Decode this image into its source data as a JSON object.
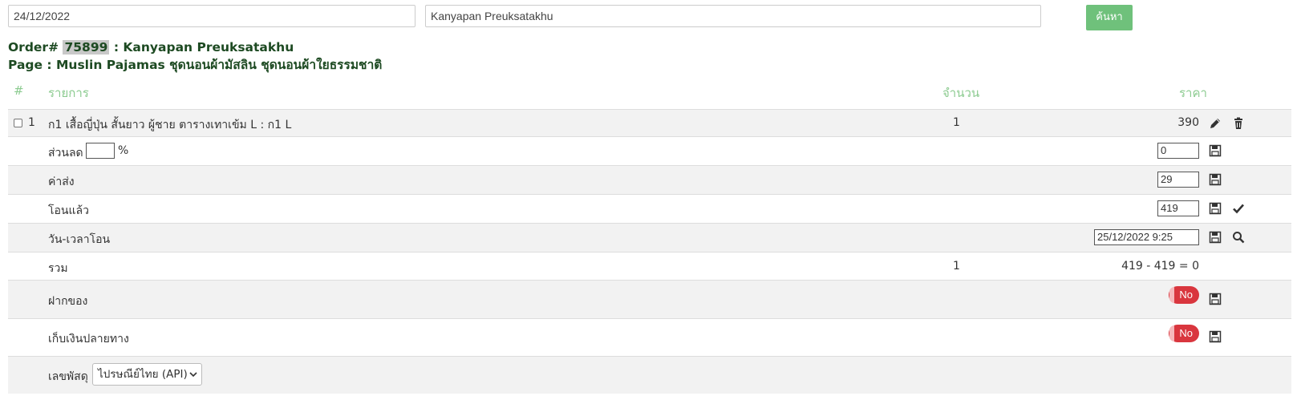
{
  "search": {
    "date_value": "24/12/2022",
    "name_value": "Kanyapan Preuksatakhu",
    "button_label": "ค้นหา"
  },
  "order": {
    "prefix": "Order#",
    "number": "75899",
    "customer": ": Kanyapan Preuksatakhu",
    "page_line": "Page : Muslin Pajamas ชุดนอนผ้ามัสลิน ชุดนอนผ้าใยธรรมชาติ"
  },
  "table": {
    "headers": {
      "index": "#",
      "item": "รายการ",
      "qty": "จำนวน",
      "price": "ราคา"
    },
    "item_row": {
      "index": "1",
      "name": "ก1 เสื้อญี่ปุ่น สั้นยาว ผู้ชาย ตารางเทาเข้ม L : ก1 L",
      "qty": "1",
      "price": "390"
    },
    "discount": {
      "label": "ส่วนลด",
      "percent_value": "",
      "percent_sign": "%",
      "value": "0"
    },
    "shipping": {
      "label": "ค่าส่ง",
      "value": "29"
    },
    "transferred": {
      "label": "โอนแล้ว",
      "value": "419"
    },
    "transfer_time": {
      "label": "วัน-เวลาโอน",
      "value": "25/12/2022 9:25"
    },
    "total": {
      "label": "รวม",
      "qty": "1",
      "value": "419 - 419 = 0"
    },
    "deposit": {
      "label": "ฝากของ",
      "toggle": "No"
    },
    "cod": {
      "label": "เก็บเงินปลายทาง",
      "toggle": "No"
    },
    "tracking": {
      "label": "เลขพัสดุ",
      "carrier": "ไปรษณีย์ไทย (API)"
    }
  },
  "colors": {
    "accent": "#6fc17b",
    "header_text": "#8ccb90",
    "toggle_off": "#d9363e",
    "title": "#1d4a22"
  },
  "icons": [
    "pencil-icon",
    "trash-icon",
    "save-icon",
    "check-icon",
    "search-icon",
    "chevron-down-icon"
  ]
}
